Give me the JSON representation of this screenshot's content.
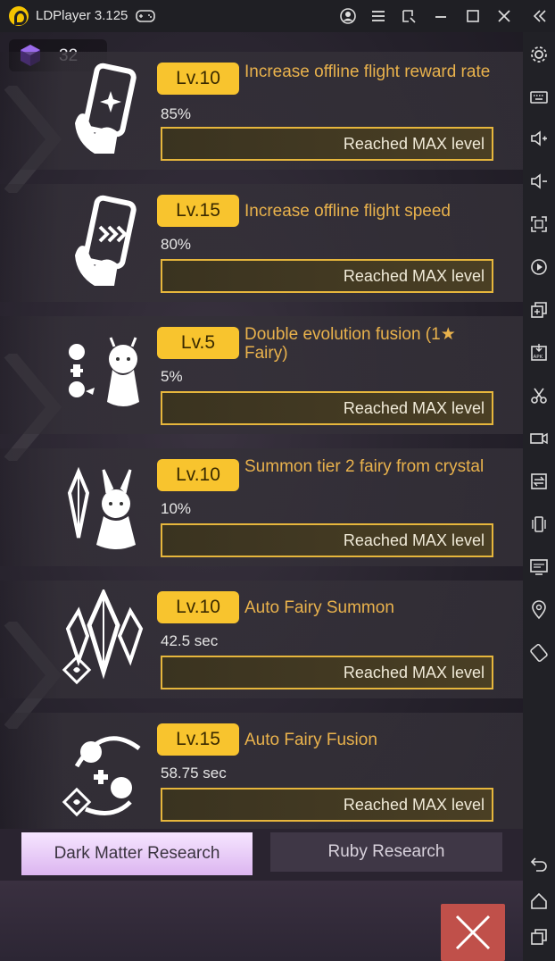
{
  "window": {
    "title": "LDPlayer 3.125",
    "controls": [
      "account-icon",
      "menu-icon",
      "screenshot-icon",
      "minimize-icon",
      "maximize-icon",
      "close-icon",
      "collapse-sidebar-icon"
    ]
  },
  "sidebar": {
    "icons": [
      "settings-icon",
      "keyboard-icon",
      "volume-up-icon",
      "volume-down-icon",
      "fullscreen-icon",
      "macro-icon",
      "multi-instance-icon",
      "apk-icon",
      "scissors-icon",
      "record-icon",
      "sync-icon",
      "shake-icon",
      "screen-icon",
      "location-icon",
      "rotate-icon",
      "back-icon",
      "home-icon",
      "recent-apps-icon"
    ]
  },
  "currency": {
    "icon": "dark-matter-cube-icon",
    "value": "32"
  },
  "research_items": [
    {
      "icon": "phone-sparkle-icon",
      "level": "Lv.10",
      "title": "Increase offline flight reward rate",
      "value": "85%",
      "status": "Reached MAX level"
    },
    {
      "icon": "phone-speed-icon",
      "level": "Lv.15",
      "title": "Increase offline flight speed",
      "value": "80%",
      "status": "Reached MAX level"
    },
    {
      "icon": "fairy-fusion-icon",
      "level": "Lv.5",
      "title": "Double evolution fusion (1★ Fairy)",
      "value": "5%",
      "status": "Reached MAX level"
    },
    {
      "icon": "crystal-fairy-icon",
      "level": "Lv.10",
      "title": "Summon tier 2 fairy from crystal",
      "value": "10%",
      "status": "Reached MAX level"
    },
    {
      "icon": "crystal-cluster-icon",
      "level": "Lv.10",
      "title": "Auto Fairy Summon",
      "value": "42.5 sec",
      "status": "Reached MAX level"
    },
    {
      "icon": "auto-fusion-icon",
      "level": "Lv.15",
      "title": "Auto Fairy Fusion",
      "value": "58.75 sec",
      "status": "Reached MAX level"
    }
  ],
  "tabs": {
    "dark_matter": "Dark Matter Research",
    "ruby": "Ruby Research"
  },
  "colors": {
    "badge": "#f8c42e",
    "title_text": "#e9b24c",
    "button_border": "#e6b63c",
    "active_tab": "#f6e5ff",
    "close_button": "#c0504a"
  }
}
